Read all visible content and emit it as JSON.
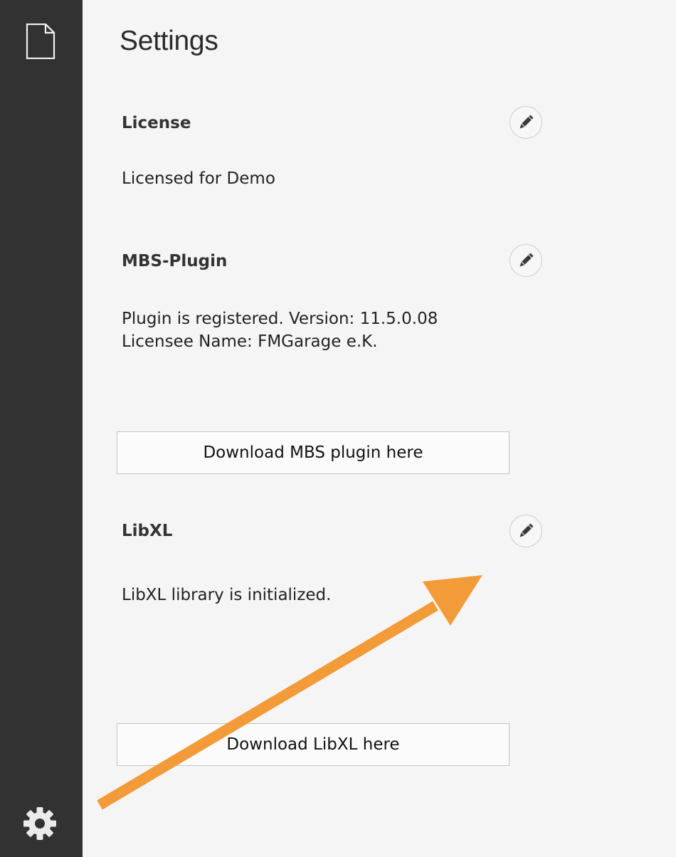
{
  "sidebar": {
    "top_icon": "document-icon",
    "bottom_icon": "gear-icon"
  },
  "page": {
    "title": "Settings"
  },
  "sections": {
    "license": {
      "title": "License",
      "text": "Licensed for Demo",
      "edit_icon": "pencil-icon"
    },
    "mbs": {
      "title": "MBS-Plugin",
      "line1": "Plugin is registered. Version: 11.5.0.08",
      "line2": "Licensee Name: FMGarage e.K.",
      "download_label": "Download MBS plugin here",
      "edit_icon": "pencil-icon"
    },
    "libxl": {
      "title": "LibXL",
      "text": "LibXL library is initialized.",
      "download_label": "Download LibXL here",
      "edit_icon": "pencil-icon"
    }
  },
  "annotation": {
    "arrow_color": "#f29b38"
  },
  "colors": {
    "sidebar_bg": "#323232",
    "main_bg": "#f5f5f5"
  }
}
